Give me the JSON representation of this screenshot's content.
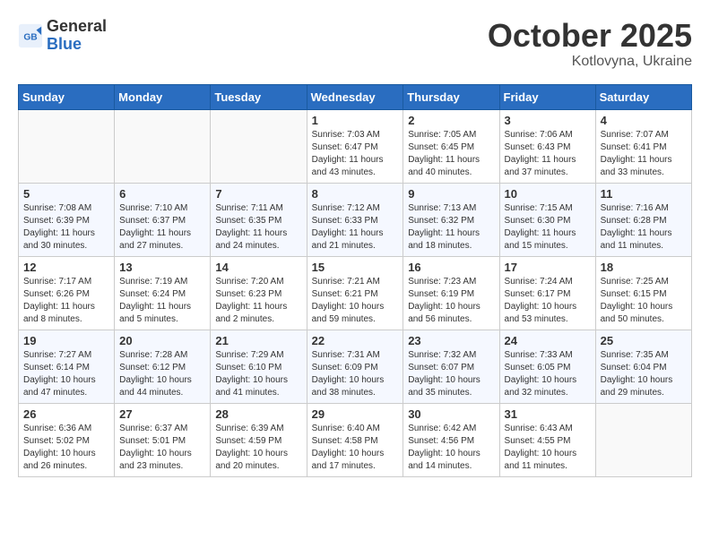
{
  "header": {
    "logo": {
      "line1": "General",
      "line2": "Blue"
    },
    "title": "October 2025",
    "location": "Kotlovyna, Ukraine"
  },
  "weekdays": [
    "Sunday",
    "Monday",
    "Tuesday",
    "Wednesday",
    "Thursday",
    "Friday",
    "Saturday"
  ],
  "weeks": [
    [
      {
        "day": "",
        "info": ""
      },
      {
        "day": "",
        "info": ""
      },
      {
        "day": "",
        "info": ""
      },
      {
        "day": "1",
        "info": "Sunrise: 7:03 AM\nSunset: 6:47 PM\nDaylight: 11 hours\nand 43 minutes."
      },
      {
        "day": "2",
        "info": "Sunrise: 7:05 AM\nSunset: 6:45 PM\nDaylight: 11 hours\nand 40 minutes."
      },
      {
        "day": "3",
        "info": "Sunrise: 7:06 AM\nSunset: 6:43 PM\nDaylight: 11 hours\nand 37 minutes."
      },
      {
        "day": "4",
        "info": "Sunrise: 7:07 AM\nSunset: 6:41 PM\nDaylight: 11 hours\nand 33 minutes."
      }
    ],
    [
      {
        "day": "5",
        "info": "Sunrise: 7:08 AM\nSunset: 6:39 PM\nDaylight: 11 hours\nand 30 minutes."
      },
      {
        "day": "6",
        "info": "Sunrise: 7:10 AM\nSunset: 6:37 PM\nDaylight: 11 hours\nand 27 minutes."
      },
      {
        "day": "7",
        "info": "Sunrise: 7:11 AM\nSunset: 6:35 PM\nDaylight: 11 hours\nand 24 minutes."
      },
      {
        "day": "8",
        "info": "Sunrise: 7:12 AM\nSunset: 6:33 PM\nDaylight: 11 hours\nand 21 minutes."
      },
      {
        "day": "9",
        "info": "Sunrise: 7:13 AM\nSunset: 6:32 PM\nDaylight: 11 hours\nand 18 minutes."
      },
      {
        "day": "10",
        "info": "Sunrise: 7:15 AM\nSunset: 6:30 PM\nDaylight: 11 hours\nand 15 minutes."
      },
      {
        "day": "11",
        "info": "Sunrise: 7:16 AM\nSunset: 6:28 PM\nDaylight: 11 hours\nand 11 minutes."
      }
    ],
    [
      {
        "day": "12",
        "info": "Sunrise: 7:17 AM\nSunset: 6:26 PM\nDaylight: 11 hours\nand 8 minutes."
      },
      {
        "day": "13",
        "info": "Sunrise: 7:19 AM\nSunset: 6:24 PM\nDaylight: 11 hours\nand 5 minutes."
      },
      {
        "day": "14",
        "info": "Sunrise: 7:20 AM\nSunset: 6:23 PM\nDaylight: 11 hours\nand 2 minutes."
      },
      {
        "day": "15",
        "info": "Sunrise: 7:21 AM\nSunset: 6:21 PM\nDaylight: 10 hours\nand 59 minutes."
      },
      {
        "day": "16",
        "info": "Sunrise: 7:23 AM\nSunset: 6:19 PM\nDaylight: 10 hours\nand 56 minutes."
      },
      {
        "day": "17",
        "info": "Sunrise: 7:24 AM\nSunset: 6:17 PM\nDaylight: 10 hours\nand 53 minutes."
      },
      {
        "day": "18",
        "info": "Sunrise: 7:25 AM\nSunset: 6:15 PM\nDaylight: 10 hours\nand 50 minutes."
      }
    ],
    [
      {
        "day": "19",
        "info": "Sunrise: 7:27 AM\nSunset: 6:14 PM\nDaylight: 10 hours\nand 47 minutes."
      },
      {
        "day": "20",
        "info": "Sunrise: 7:28 AM\nSunset: 6:12 PM\nDaylight: 10 hours\nand 44 minutes."
      },
      {
        "day": "21",
        "info": "Sunrise: 7:29 AM\nSunset: 6:10 PM\nDaylight: 10 hours\nand 41 minutes."
      },
      {
        "day": "22",
        "info": "Sunrise: 7:31 AM\nSunset: 6:09 PM\nDaylight: 10 hours\nand 38 minutes."
      },
      {
        "day": "23",
        "info": "Sunrise: 7:32 AM\nSunset: 6:07 PM\nDaylight: 10 hours\nand 35 minutes."
      },
      {
        "day": "24",
        "info": "Sunrise: 7:33 AM\nSunset: 6:05 PM\nDaylight: 10 hours\nand 32 minutes."
      },
      {
        "day": "25",
        "info": "Sunrise: 7:35 AM\nSunset: 6:04 PM\nDaylight: 10 hours\nand 29 minutes."
      }
    ],
    [
      {
        "day": "26",
        "info": "Sunrise: 6:36 AM\nSunset: 5:02 PM\nDaylight: 10 hours\nand 26 minutes."
      },
      {
        "day": "27",
        "info": "Sunrise: 6:37 AM\nSunset: 5:01 PM\nDaylight: 10 hours\nand 23 minutes."
      },
      {
        "day": "28",
        "info": "Sunrise: 6:39 AM\nSunset: 4:59 PM\nDaylight: 10 hours\nand 20 minutes."
      },
      {
        "day": "29",
        "info": "Sunrise: 6:40 AM\nSunset: 4:58 PM\nDaylight: 10 hours\nand 17 minutes."
      },
      {
        "day": "30",
        "info": "Sunrise: 6:42 AM\nSunset: 4:56 PM\nDaylight: 10 hours\nand 14 minutes."
      },
      {
        "day": "31",
        "info": "Sunrise: 6:43 AM\nSunset: 4:55 PM\nDaylight: 10 hours\nand 11 minutes."
      },
      {
        "day": "",
        "info": ""
      }
    ]
  ]
}
